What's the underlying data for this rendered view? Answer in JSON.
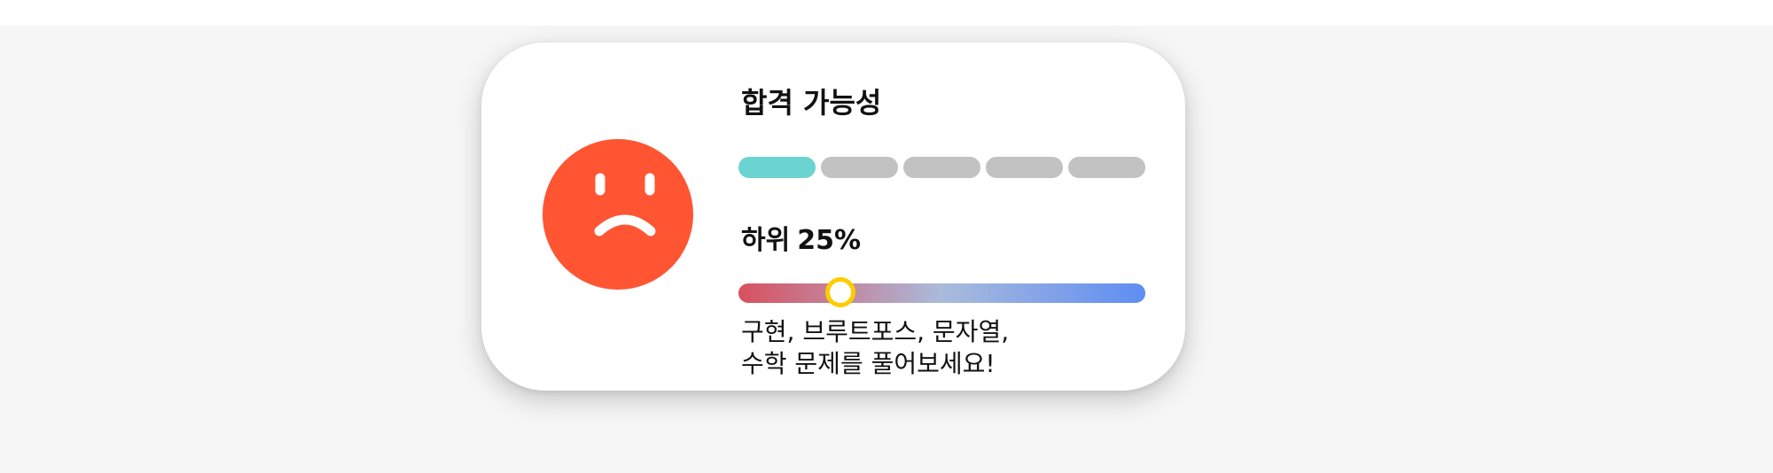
{
  "card": {
    "title": "합격 가능성",
    "status_icon": "sad-face-icon",
    "face_color": "#ff5533",
    "probability": {
      "segments_total": 5,
      "segments_filled": 1,
      "filled_color": "#6bd3d0",
      "empty_color": "#c2c2c2"
    },
    "rank": {
      "label": "하위",
      "value": "25%"
    },
    "percentile_slider": {
      "value_percent": 25,
      "gradient_colors": [
        "#d9505f",
        "#aabbdc",
        "#5e8df2"
      ],
      "knob_color": "#ffcc00"
    },
    "advice": {
      "line1": "구현, 브루트포스, 문자열,",
      "line2": "수학 문제를 풀어보세요!"
    }
  }
}
